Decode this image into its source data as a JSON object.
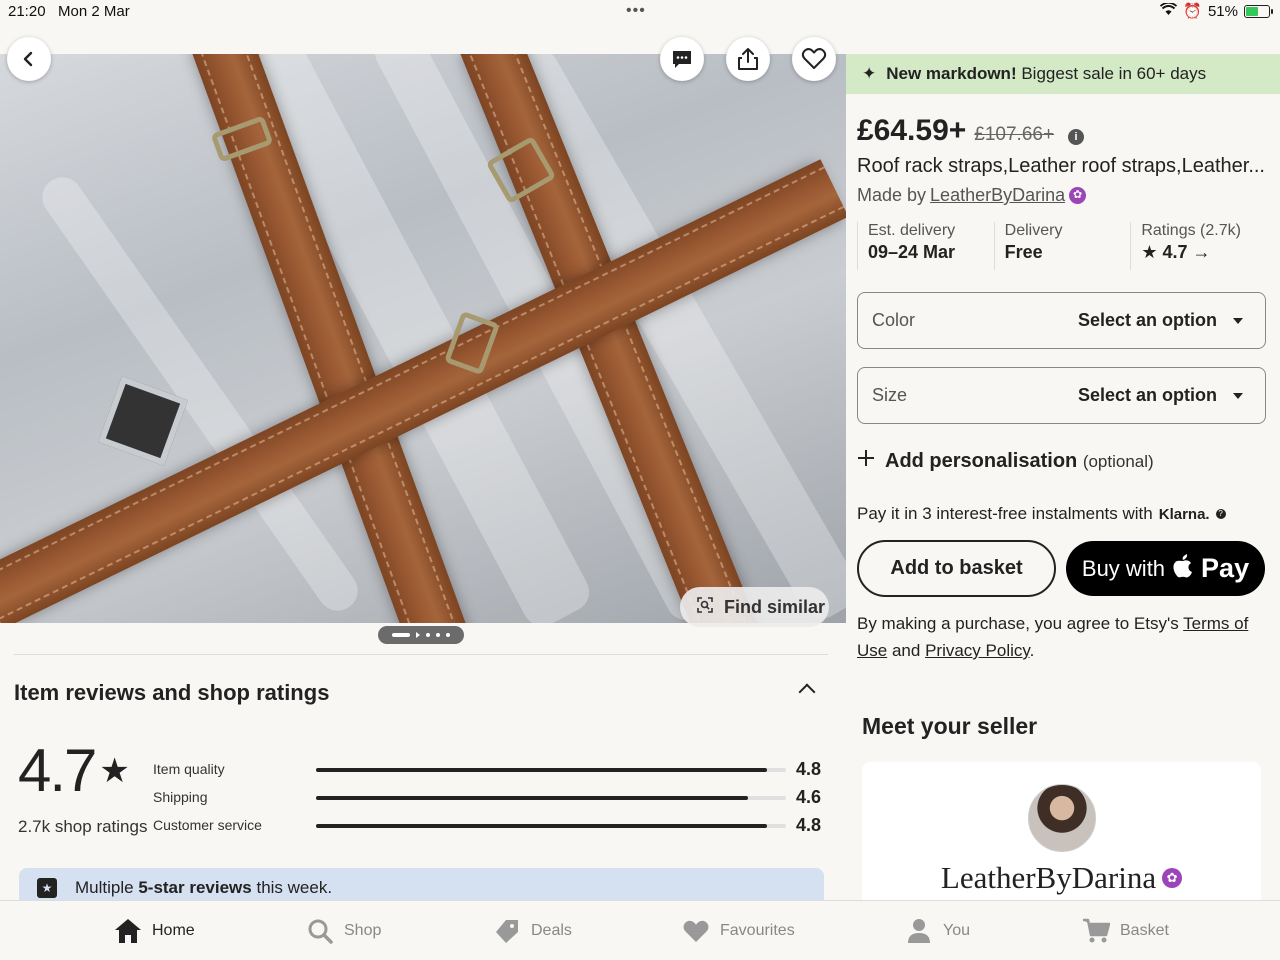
{
  "status": {
    "time": "21:20",
    "date": "Mon 2 Mar",
    "battery": "51%"
  },
  "hero": {
    "find_similar": "Find similar"
  },
  "banner": {
    "bold": "New markdown!",
    "text": "Biggest sale in 60+ days"
  },
  "product": {
    "price": "£64.59+",
    "old_price": "£107.66+",
    "title": "Roof rack straps,Leather roof straps,Leather...",
    "made_by_prefix": "Made by",
    "seller": "LeatherByDarina"
  },
  "facts": [
    {
      "label": "Est. delivery",
      "value": "09–24 Mar"
    },
    {
      "label": "Delivery",
      "value": "Free"
    },
    {
      "label": "Ratings (2.7k)",
      "value": "★ 4.7 →"
    }
  ],
  "options": {
    "color": {
      "label": "Color",
      "value": "Select an option"
    },
    "size": {
      "label": "Size",
      "value": "Select an option"
    }
  },
  "personalisation": {
    "label": "Add personalisation",
    "optional": "(optional)"
  },
  "klarna": {
    "text": "Pay it in 3 interest-free instalments with",
    "brand": "Klarna."
  },
  "buttons": {
    "basket": "Add to basket",
    "buy_with": "Buy with",
    "pay": "Pay"
  },
  "legal": {
    "prefix": "By making a purchase, you agree to Etsy's",
    "terms": "Terms of Use",
    "and": "and",
    "privacy": "Privacy Policy",
    "end": "."
  },
  "seller_section": {
    "heading": "Meet your seller",
    "name": "LeatherByDarina"
  },
  "reviews": {
    "title": "Item reviews and shop ratings",
    "overall": "4.7",
    "shop_ratings": "2.7k shop ratings",
    "metrics": [
      {
        "label": "Item quality",
        "value": "4.8",
        "fraction": 0.96
      },
      {
        "label": "Shipping",
        "value": "4.6",
        "fraction": 0.92
      },
      {
        "label": "Customer service",
        "value": "4.8",
        "fraction": 0.96
      }
    ],
    "notice_prefix": "Multiple",
    "notice_bold": "5-star reviews",
    "notice_suffix": "this week."
  },
  "tabs": [
    {
      "label": "Home",
      "icon": "home-icon",
      "active": true
    },
    {
      "label": "Shop",
      "icon": "search-icon",
      "active": false
    },
    {
      "label": "Deals",
      "icon": "tag-icon",
      "active": false
    },
    {
      "label": "Favourites",
      "icon": "heart-icon",
      "active": false
    },
    {
      "label": "You",
      "icon": "person-icon",
      "active": false
    },
    {
      "label": "Basket",
      "icon": "cart-icon",
      "active": false
    }
  ],
  "colors": {
    "accent": "#222222",
    "banner_green": "#d4e9c5",
    "notice_blue": "#d5e1f1",
    "star_badge": "#9b45b8"
  }
}
